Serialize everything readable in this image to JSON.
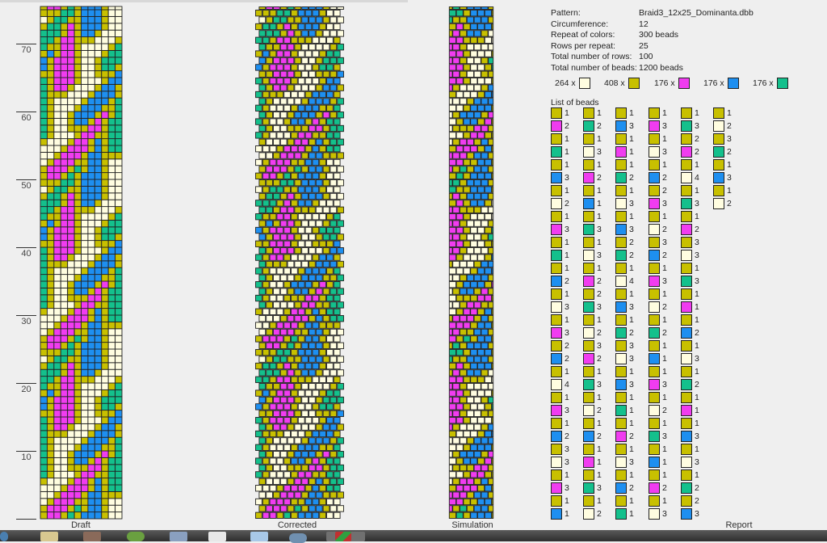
{
  "panels": {
    "draft": "Draft",
    "corrected": "Corrected",
    "simulation": "Simulation",
    "report": "Report"
  },
  "axis": {
    "ticks": [
      "10",
      "20",
      "30",
      "40",
      "50",
      "60",
      "70"
    ]
  },
  "palette": {
    "w": "#fffde0",
    "y": "#c8c000",
    "p": "#f03cf0",
    "b": "#1e8ff0",
    "g": "#14c08c"
  },
  "report": {
    "info": [
      {
        "label": "Pattern:",
        "value": "Braid3_12x25_Dominanta.dbb"
      },
      {
        "label": "Circumference:",
        "value": "12"
      },
      {
        "label": "Repeat of colors:",
        "value": "300 beads"
      },
      {
        "label": "Rows per repeat:",
        "value": "25"
      },
      {
        "label": "Total number of rows:",
        "value": "100"
      },
      {
        "label": "Total number of beads:",
        "value": "1200 beads"
      }
    ],
    "color_counts": [
      {
        "count": "264 x",
        "color": "w"
      },
      {
        "count": "408 x",
        "color": "y"
      },
      {
        "count": "176 x",
        "color": "p"
      },
      {
        "count": "176 x",
        "color": "b"
      },
      {
        "count": "176 x",
        "color": "g"
      }
    ],
    "list_title": "List of beads",
    "list_columns": [
      [
        [
          "y",
          1
        ],
        [
          "p",
          2
        ],
        [
          "y",
          1
        ],
        [
          "g",
          1
        ],
        [
          "y",
          1
        ],
        [
          "b",
          3
        ],
        [
          "y",
          1
        ],
        [
          "w",
          2
        ],
        [
          "y",
          1
        ],
        [
          "p",
          3
        ],
        [
          "y",
          1
        ],
        [
          "g",
          1
        ],
        [
          "y",
          1
        ],
        [
          "b",
          2
        ],
        [
          "y",
          1
        ],
        [
          "w",
          3
        ],
        [
          "y",
          1
        ],
        [
          "p",
          3
        ],
        [
          "y",
          2
        ],
        [
          "b",
          2
        ],
        [
          "y",
          1
        ],
        [
          "w",
          4
        ],
        [
          "y",
          1
        ],
        [
          "p",
          3
        ],
        [
          "y",
          1
        ],
        [
          "b",
          2
        ],
        [
          "y",
          3
        ],
        [
          "w",
          3
        ],
        [
          "y",
          1
        ],
        [
          "p",
          3
        ],
        [
          "y",
          1
        ],
        [
          "b",
          1
        ]
      ],
      [
        [
          "y",
          1
        ],
        [
          "g",
          2
        ],
        [
          "y",
          1
        ],
        [
          "w",
          3
        ],
        [
          "y",
          1
        ],
        [
          "p",
          2
        ],
        [
          "y",
          1
        ],
        [
          "b",
          1
        ],
        [
          "y",
          1
        ],
        [
          "g",
          3
        ],
        [
          "y",
          1
        ],
        [
          "w",
          3
        ],
        [
          "y",
          1
        ],
        [
          "p",
          2
        ],
        [
          "y",
          2
        ],
        [
          "g",
          3
        ],
        [
          "y",
          1
        ],
        [
          "w",
          2
        ],
        [
          "y",
          3
        ],
        [
          "p",
          2
        ],
        [
          "y",
          1
        ],
        [
          "g",
          3
        ],
        [
          "y",
          1
        ],
        [
          "w",
          2
        ],
        [
          "y",
          1
        ],
        [
          "b",
          2
        ],
        [
          "y",
          1
        ],
        [
          "p",
          1
        ],
        [
          "y",
          1
        ],
        [
          "g",
          3
        ],
        [
          "y",
          1
        ],
        [
          "w",
          2
        ]
      ],
      [
        [
          "y",
          1
        ],
        [
          "b",
          3
        ],
        [
          "y",
          1
        ],
        [
          "p",
          1
        ],
        [
          "y",
          1
        ],
        [
          "g",
          2
        ],
        [
          "y",
          1
        ],
        [
          "w",
          3
        ],
        [
          "y",
          1
        ],
        [
          "b",
          3
        ],
        [
          "y",
          2
        ],
        [
          "g",
          2
        ],
        [
          "y",
          1
        ],
        [
          "w",
          4
        ],
        [
          "y",
          1
        ],
        [
          "b",
          3
        ],
        [
          "y",
          1
        ],
        [
          "g",
          2
        ],
        [
          "y",
          3
        ],
        [
          "w",
          3
        ],
        [
          "y",
          1
        ],
        [
          "b",
          3
        ],
        [
          "y",
          1
        ],
        [
          "g",
          1
        ],
        [
          "y",
          1
        ],
        [
          "p",
          2
        ],
        [
          "y",
          1
        ],
        [
          "w",
          3
        ],
        [
          "y",
          1
        ],
        [
          "b",
          2
        ],
        [
          "y",
          1
        ],
        [
          "g",
          1
        ]
      ],
      [
        [
          "y",
          1
        ],
        [
          "p",
          3
        ],
        [
          "y",
          1
        ],
        [
          "w",
          3
        ],
        [
          "y",
          1
        ],
        [
          "b",
          2
        ],
        [
          "y",
          2
        ],
        [
          "p",
          3
        ],
        [
          "y",
          1
        ],
        [
          "w",
          2
        ],
        [
          "y",
          3
        ],
        [
          "b",
          2
        ],
        [
          "y",
          1
        ],
        [
          "p",
          3
        ],
        [
          "y",
          1
        ],
        [
          "w",
          2
        ],
        [
          "y",
          1
        ],
        [
          "g",
          2
        ],
        [
          "y",
          1
        ],
        [
          "b",
          1
        ],
        [
          "y",
          1
        ],
        [
          "p",
          3
        ],
        [
          "y",
          1
        ],
        [
          "w",
          2
        ],
        [
          "y",
          1
        ],
        [
          "g",
          3
        ],
        [
          "y",
          1
        ],
        [
          "b",
          1
        ],
        [
          "y",
          1
        ],
        [
          "p",
          2
        ],
        [
          "y",
          1
        ],
        [
          "w",
          3
        ]
      ],
      [
        [
          "y",
          1
        ],
        [
          "g",
          3
        ],
        [
          "y",
          2
        ],
        [
          "p",
          2
        ],
        [
          "y",
          1
        ],
        [
          "w",
          4
        ],
        [
          "y",
          1
        ],
        [
          "g",
          3
        ],
        [
          "y",
          1
        ],
        [
          "p",
          2
        ],
        [
          "y",
          3
        ],
        [
          "w",
          3
        ],
        [
          "y",
          1
        ],
        [
          "g",
          3
        ],
        [
          "y",
          1
        ],
        [
          "p",
          1
        ],
        [
          "y",
          1
        ],
        [
          "b",
          2
        ],
        [
          "y",
          1
        ],
        [
          "w",
          3
        ],
        [
          "y",
          1
        ],
        [
          "g",
          2
        ],
        [
          "y",
          1
        ],
        [
          "p",
          1
        ],
        [
          "y",
          1
        ],
        [
          "b",
          3
        ],
        [
          "y",
          1
        ],
        [
          "w",
          3
        ],
        [
          "y",
          1
        ],
        [
          "g",
          2
        ],
        [
          "y",
          2
        ],
        [
          "b",
          3
        ]
      ],
      [
        [
          "y",
          1
        ],
        [
          "w",
          2
        ],
        [
          "y",
          3
        ],
        [
          "g",
          2
        ],
        [
          "y",
          1
        ],
        [
          "b",
          3
        ],
        [
          "y",
          1
        ],
        [
          "w",
          2
        ]
      ]
    ]
  }
}
